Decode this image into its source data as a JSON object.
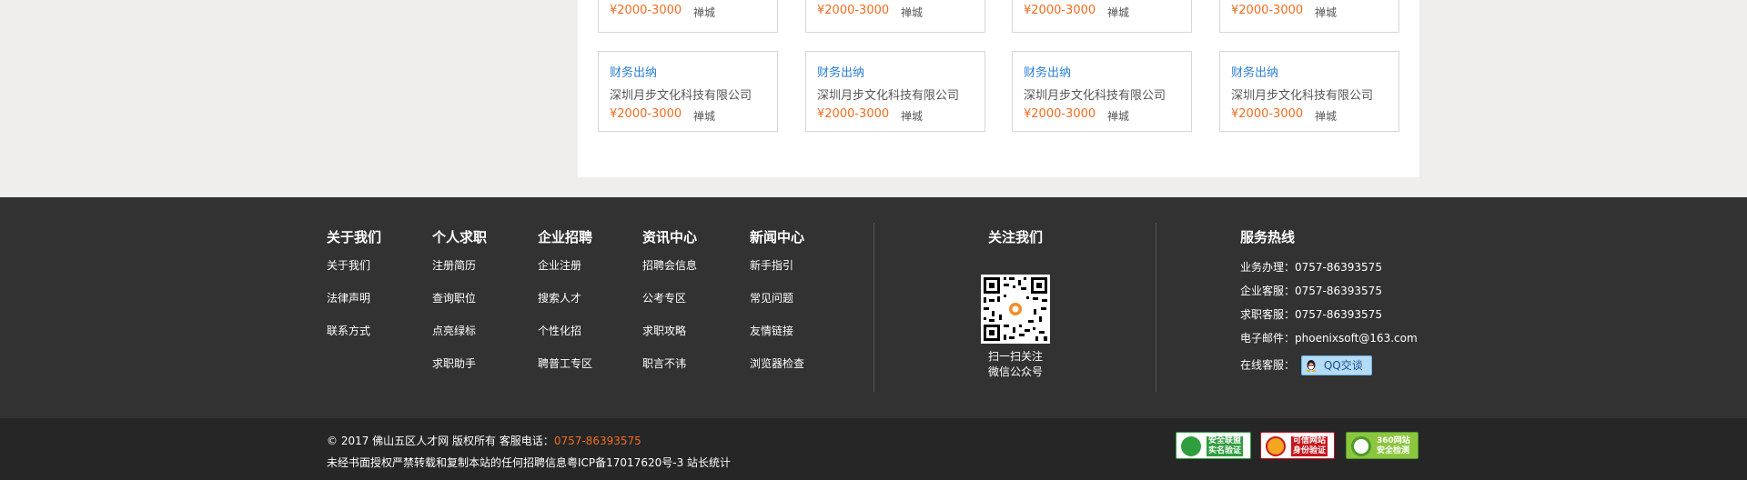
{
  "job_cards": [
    {
      "title": "财务出纳",
      "company": "深圳月步文化科技有限公司",
      "salary": "¥2000-3000",
      "location": "禅城"
    }
  ],
  "top_row_cards": [
    {
      "salary": "¥2000-3000",
      "location": "禅城"
    },
    {
      "salary": "¥2000-3000",
      "location": "禅城"
    },
    {
      "salary": "¥2000-3000",
      "location": "禅城"
    },
    {
      "salary": "¥2000-3000",
      "location": "禅城"
    }
  ],
  "bottom_row_cards": [
    {
      "title": "财务出纳",
      "company": "深圳月步文化科技有限公司",
      "salary": "¥2000-3000",
      "location": "禅城"
    },
    {
      "title": "财务出纳",
      "company": "深圳月步文化科技有限公司",
      "salary": "¥2000-3000",
      "location": "禅城"
    },
    {
      "title": "财务出纳",
      "company": "深圳月步文化科技有限公司",
      "salary": "¥2000-3000",
      "location": "禅城"
    },
    {
      "title": "财务出纳",
      "company": "深圳月步文化科技有限公司",
      "salary": "¥2000-3000",
      "location": "禅城"
    }
  ],
  "footer": {
    "columns": [
      {
        "title": "关于我们",
        "links": [
          "关于我们",
          "法律声明",
          "联系方式"
        ]
      },
      {
        "title": "个人求职",
        "links": [
          "注册简历",
          "查询职位",
          "点亮绿标",
          "求职助手"
        ]
      },
      {
        "title": "企业招聘",
        "links": [
          "企业注册",
          "搜索人才",
          "个性化招",
          "聘普工专区"
        ]
      },
      {
        "title": "资讯中心",
        "links": [
          "招聘会信息",
          "公考专区",
          "求职攻略",
          "职言不讳"
        ]
      },
      {
        "title": "新闻中心",
        "links": [
          "新手指引",
          "常见问题",
          "友情链接",
          "浏览器检查"
        ]
      }
    ],
    "follow": {
      "title": "关注我们",
      "qr_caption_1": "扫一扫关注",
      "qr_caption_2": "微信公众号"
    },
    "hotline": {
      "title": "服务热线",
      "rows": [
        "业务办理：0757-86393575",
        "企业客服：0757-86393575",
        "求职客服：0757-86393575",
        "电子邮件：phoenixsoft@163.com"
      ],
      "online_label": "在线客服：",
      "qq_button": "QQ交谈"
    }
  },
  "bottom_bar": {
    "copyright": "© 2017 佛山五区人才网 版权所有 客服电话：",
    "phone": "0757-86393575",
    "notice": "未经书面授权严禁转载和复制本站的任何招聘信息粤ICP备17017620号-3 站长统计",
    "badges": [
      {
        "line1": "安全联盟",
        "line2": "实名验证",
        "color": "#2f9e3f"
      },
      {
        "line1": "可信网站",
        "line2": "身份验证",
        "color": "#c8161d"
      },
      {
        "line1": "360网站",
        "line2": "安全检测",
        "color": "#4c9a2a"
      }
    ]
  }
}
